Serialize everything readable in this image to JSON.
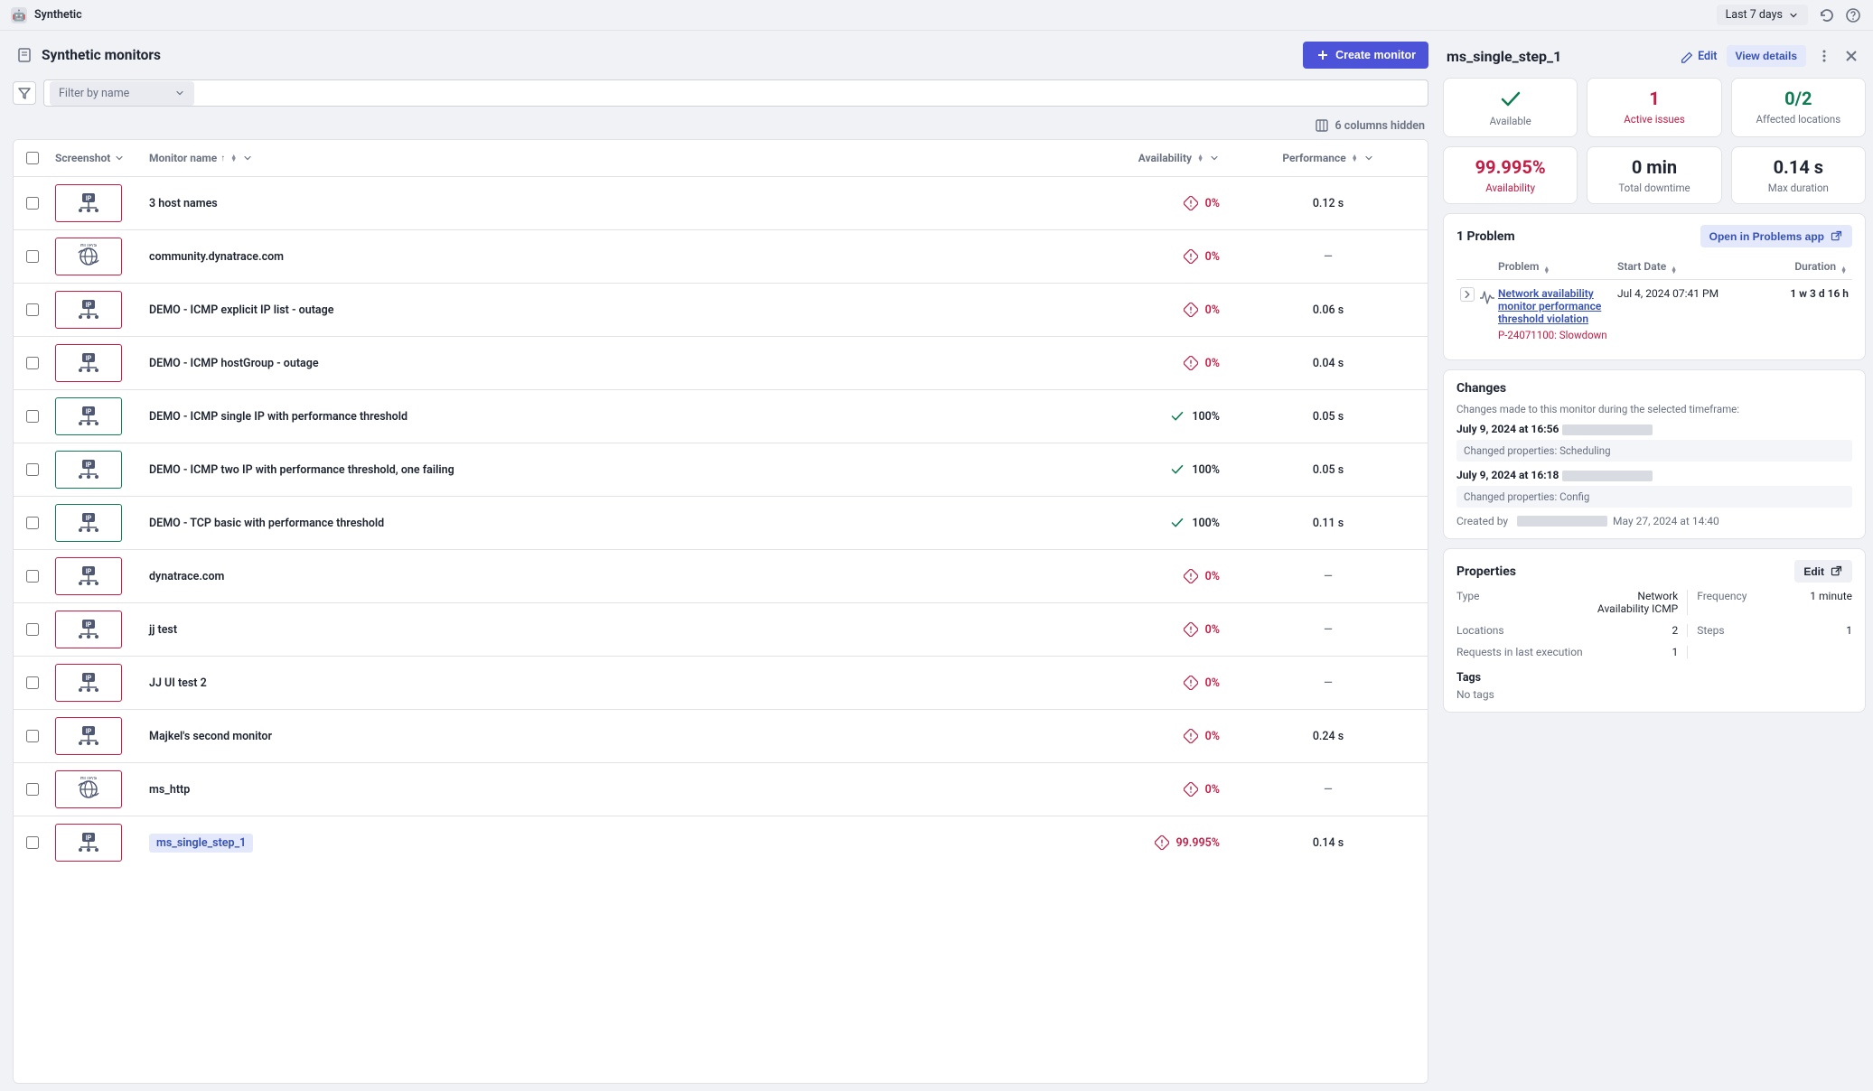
{
  "app": {
    "title": "Synthetic"
  },
  "topbar": {
    "time_label": "Last 7 days"
  },
  "page": {
    "title": "Synthetic monitors",
    "create_btn": "Create monitor",
    "filter_placeholder": "Filter by name",
    "columns_hidden": "6 columns hidden"
  },
  "columns": {
    "screenshot": "Screenshot",
    "name": "Monitor name",
    "availability": "Availability",
    "performance": "Performance"
  },
  "rows": [
    {
      "icon": "ip",
      "name": "3 host names",
      "avail": "0%",
      "avail_ok": false,
      "perf": "0.12 s",
      "selected": false
    },
    {
      "icon": "https",
      "name": "community.dynatrace.com",
      "avail": "0%",
      "avail_ok": false,
      "perf": "—",
      "selected": false
    },
    {
      "icon": "ip",
      "name": "DEMO - ICMP explicit IP list - outage",
      "avail": "0%",
      "avail_ok": false,
      "perf": "0.06 s",
      "selected": false
    },
    {
      "icon": "ip",
      "name": "DEMO - ICMP hostGroup - outage",
      "avail": "0%",
      "avail_ok": false,
      "perf": "0.04 s",
      "selected": false
    },
    {
      "icon": "ip",
      "name": "DEMO - ICMP single IP with performance threshold",
      "avail": "100%",
      "avail_ok": true,
      "perf": "0.05 s",
      "selected": false
    },
    {
      "icon": "ip",
      "name": "DEMO - ICMP two IP with performance threshold, one failing",
      "avail": "100%",
      "avail_ok": true,
      "perf": "0.05 s",
      "selected": false
    },
    {
      "icon": "ip",
      "name": "DEMO - TCP basic with performance threshold",
      "avail": "100%",
      "avail_ok": true,
      "perf": "0.11 s",
      "selected": false
    },
    {
      "icon": "ip",
      "name": "dynatrace.com",
      "avail": "0%",
      "avail_ok": false,
      "perf": "—",
      "selected": false
    },
    {
      "icon": "ip",
      "name": "jj test",
      "avail": "0%",
      "avail_ok": false,
      "perf": "—",
      "selected": false
    },
    {
      "icon": "ip",
      "name": "JJ UI test 2",
      "avail": "0%",
      "avail_ok": false,
      "perf": "—",
      "selected": false
    },
    {
      "icon": "ip",
      "name": "Majkel's second monitor",
      "avail": "0%",
      "avail_ok": false,
      "perf": "0.24 s",
      "selected": false
    },
    {
      "icon": "https",
      "name": "ms_http",
      "avail": "0%",
      "avail_ok": false,
      "perf": "—",
      "selected": false
    },
    {
      "icon": "ip",
      "name": "ms_single_step_1",
      "avail": "99.995%",
      "avail_ok": false,
      "perf": "0.14 s",
      "selected": true
    }
  ],
  "detail": {
    "title": "ms_single_step_1",
    "edit": "Edit",
    "view_details": "View details",
    "stats": {
      "available": "Available",
      "active_issues_val": "1",
      "active_issues": "Active issues",
      "affected_val": "0/2",
      "affected": "Affected locations",
      "avail_pct": "99.995%",
      "avail_lbl": "Availability",
      "downtime_val": "0 min",
      "downtime_lbl": "Total downtime",
      "maxdur_val": "0.14 s",
      "maxdur_lbl": "Max duration"
    },
    "problems": {
      "title": "1 Problem",
      "open_btn": "Open in Problems app",
      "cols": {
        "problem": "Problem",
        "start": "Start Date",
        "duration": "Duration"
      },
      "row": {
        "link": "Network availability monitor performance threshold violation",
        "id": "P-24071100",
        "kind": "Slowdown",
        "start": "Jul 4, 2024 07:41 PM",
        "duration": "1 w 3 d 16 h"
      }
    },
    "changes": {
      "title": "Changes",
      "note": "Changes made to this monitor during the selected timeframe:",
      "items": [
        {
          "ts": "July 9, 2024 at 16:56",
          "props": "Changed properties: Scheduling"
        },
        {
          "ts": "July 9, 2024 at 16:18",
          "props": "Changed properties: Config"
        }
      ],
      "created_label": "Created by",
      "created_ts": "May 27, 2024 at 14:40"
    },
    "props": {
      "title": "Properties",
      "edit": "Edit",
      "type_k": "Type",
      "type_v": "Network Availability ICMP",
      "freq_k": "Frequency",
      "freq_v": "1 minute",
      "loc_k": "Locations",
      "loc_v": "2",
      "steps_k": "Steps",
      "steps_v": "1",
      "req_k": "Requests in last execution",
      "req_v": "1",
      "tags_title": "Tags",
      "no_tags": "No tags"
    }
  }
}
